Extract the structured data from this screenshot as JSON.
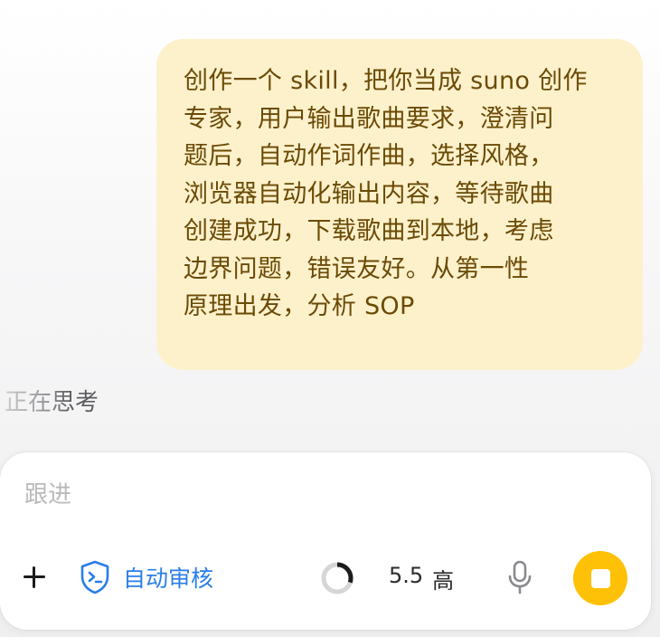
{
  "message": {
    "lines": [
      "创作一个 skill，把你当成 suno 创作",
      "专家，用户输出歌曲要求，澄清问",
      "题后，自动作词作曲，选择风格，",
      "浏览器自动化输出内容，等待歌曲",
      "创建成功，下载歌曲到本地，考虑",
      "边界问题，错误友好。从第一性",
      "原理出发，分析 SOP"
    ]
  },
  "status": {
    "thinking_label": "正在思考"
  },
  "composer": {
    "placeholder": "跟进",
    "auto_review_label": "自动审核",
    "model_version": "5.5",
    "effort_label": "高",
    "context_usage_fraction": 0.3
  },
  "icons": {
    "add": "plus-icon",
    "auto_review": "shield-terminal-icon",
    "context": "progress-ring-icon",
    "voice": "microphone-icon",
    "stop": "stop-icon"
  },
  "colors": {
    "bubble_bg": "#fdf1cc",
    "bubble_text": "#6b4a05",
    "accent_blue": "#2a7ee8",
    "stop_button": "#ffc107"
  }
}
